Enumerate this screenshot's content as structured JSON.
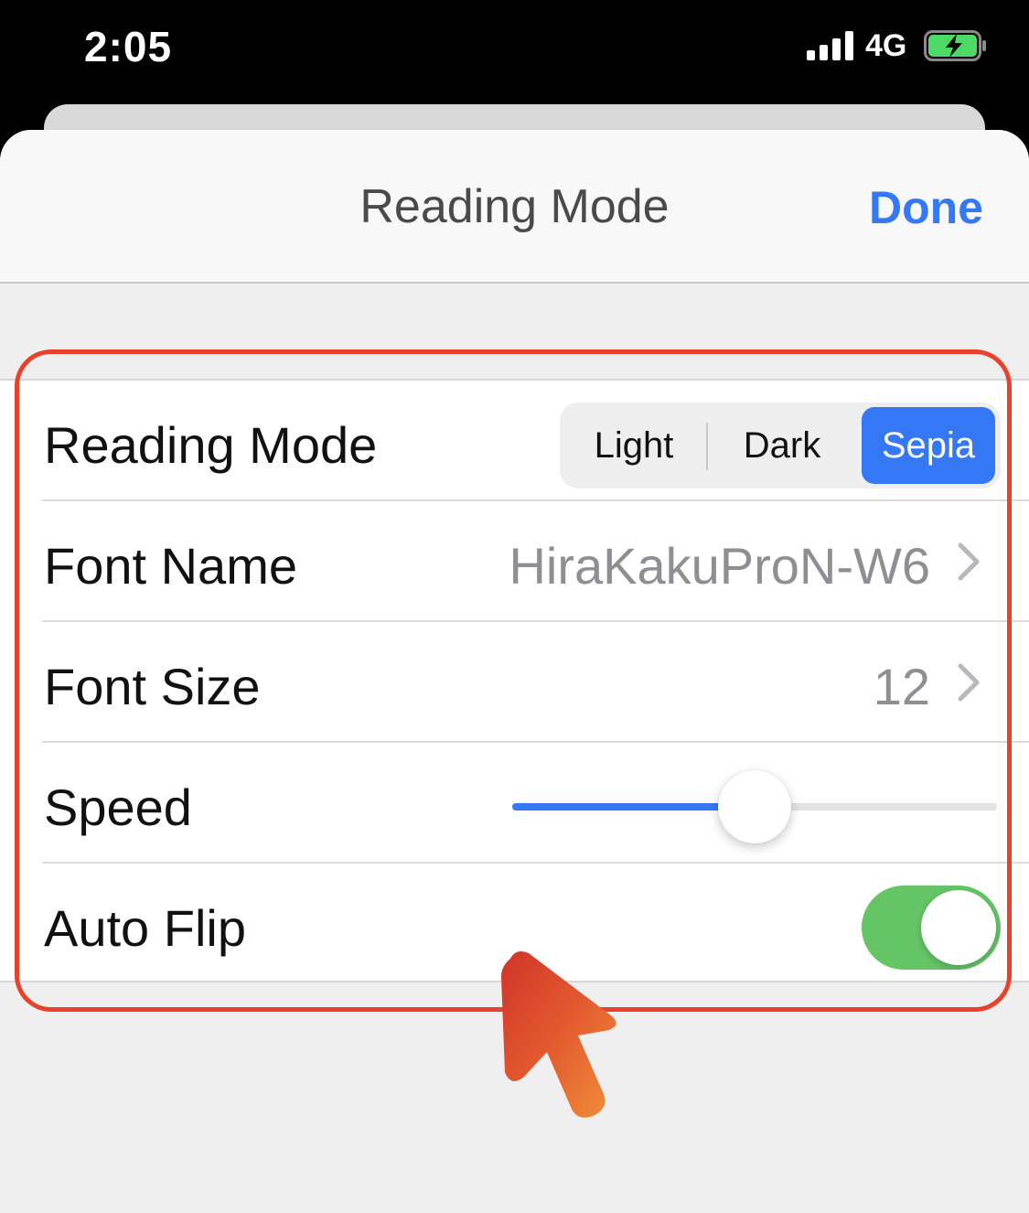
{
  "status_bar": {
    "time": "2:05",
    "network": "4G"
  },
  "nav": {
    "title": "Reading Mode",
    "done_label": "Done"
  },
  "settings": {
    "reading_mode": {
      "label": "Reading Mode",
      "options": [
        "Light",
        "Dark",
        "Sepia"
      ],
      "selected": "Sepia"
    },
    "font_name": {
      "label": "Font Name",
      "value": "HiraKakuProN-W6"
    },
    "font_size": {
      "label": "Font Size",
      "value": "12"
    },
    "speed": {
      "label": "Speed",
      "value_fraction": 0.5
    },
    "auto_flip": {
      "label": "Auto Flip",
      "enabled": true
    }
  },
  "colors": {
    "accent": "#3478f6",
    "toggle_on": "#65c466",
    "annotation": "#e8412c"
  },
  "icons": [
    "signal-icon",
    "battery-charging-icon",
    "chevron-right-icon",
    "pointer-arrow-icon"
  ]
}
